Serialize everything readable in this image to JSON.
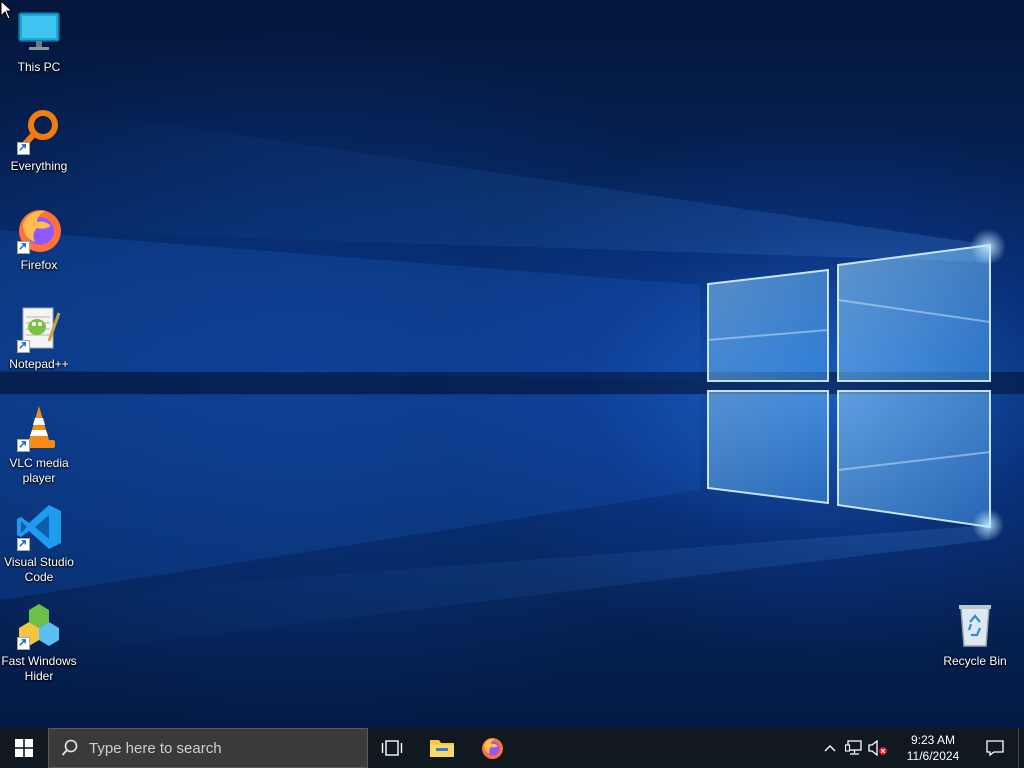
{
  "desktop": {
    "icons": [
      {
        "label": "This PC",
        "icon": "monitor-icon",
        "shortcut": false
      },
      {
        "label": "Everything",
        "icon": "magnifier-ring-icon",
        "shortcut": true
      },
      {
        "label": "Firefox",
        "icon": "firefox-icon",
        "shortcut": true
      },
      {
        "label": "Notepad++",
        "icon": "notepad-plus-plus-icon",
        "shortcut": true
      },
      {
        "label": "VLC media player",
        "icon": "traffic-cone-icon",
        "shortcut": true
      },
      {
        "label": "Visual Studio Code",
        "icon": "vscode-icon",
        "shortcut": true
      },
      {
        "label": "Fast Windows Hider",
        "icon": "cubes-icon",
        "shortcut": true
      },
      {
        "label": "Recycle Bin",
        "icon": "recycle-bin-icon",
        "shortcut": false
      }
    ]
  },
  "taskbar": {
    "search_placeholder": "Type here to search",
    "pinned": [
      {
        "name": "Task View",
        "icon": "task-view-icon"
      },
      {
        "name": "File Explorer",
        "icon": "folder-icon"
      },
      {
        "name": "Firefox",
        "icon": "firefox-icon"
      }
    ],
    "tray": {
      "icons": [
        "chevron-up-icon",
        "network-icon",
        "speaker-muted-icon"
      ],
      "time": "9:23 AM",
      "date": "11/6/2024"
    }
  },
  "colors": {
    "taskbar_bg": "#101820",
    "search_bg": "#3a3a3a",
    "windows_blue": "#00a4ef",
    "wallpaper_glow": "#2f8cff"
  }
}
